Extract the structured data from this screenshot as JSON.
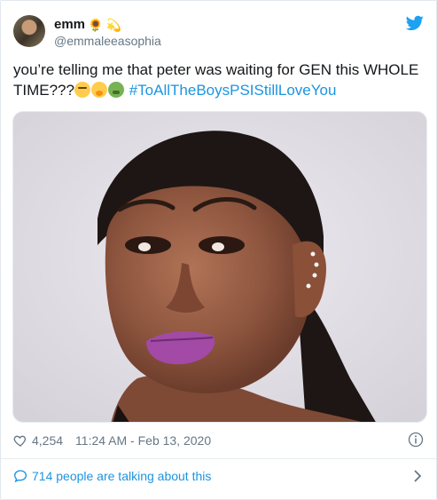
{
  "tweet": {
    "display_name": "emm",
    "name_emojis": [
      "🌻",
      "💫"
    ],
    "handle": "@emmaleeasophia",
    "text_before": "you’re telling me that peter was waiting for GEN this WHOLE TIME???",
    "emojis": [
      "face-with-rolling-eyes-emoji",
      "shushing-face-emoji",
      "nauseated-face-emoji"
    ],
    "hashtag": "#ToAllTheBoysPSIStillLoveYou",
    "likes": "4,254",
    "timestamp": "11:24 AM - Feb 13, 2020",
    "talking": "714 people are talking about this"
  },
  "colors": {
    "link": "#1b95e0",
    "secondary_text": "#657786",
    "primary_text": "#14171a",
    "border": "#e6ecf0"
  },
  "icons": [
    "twitter-logo-icon",
    "heart-icon",
    "info-icon",
    "speech-bubble-icon",
    "chevron-right-icon"
  ]
}
